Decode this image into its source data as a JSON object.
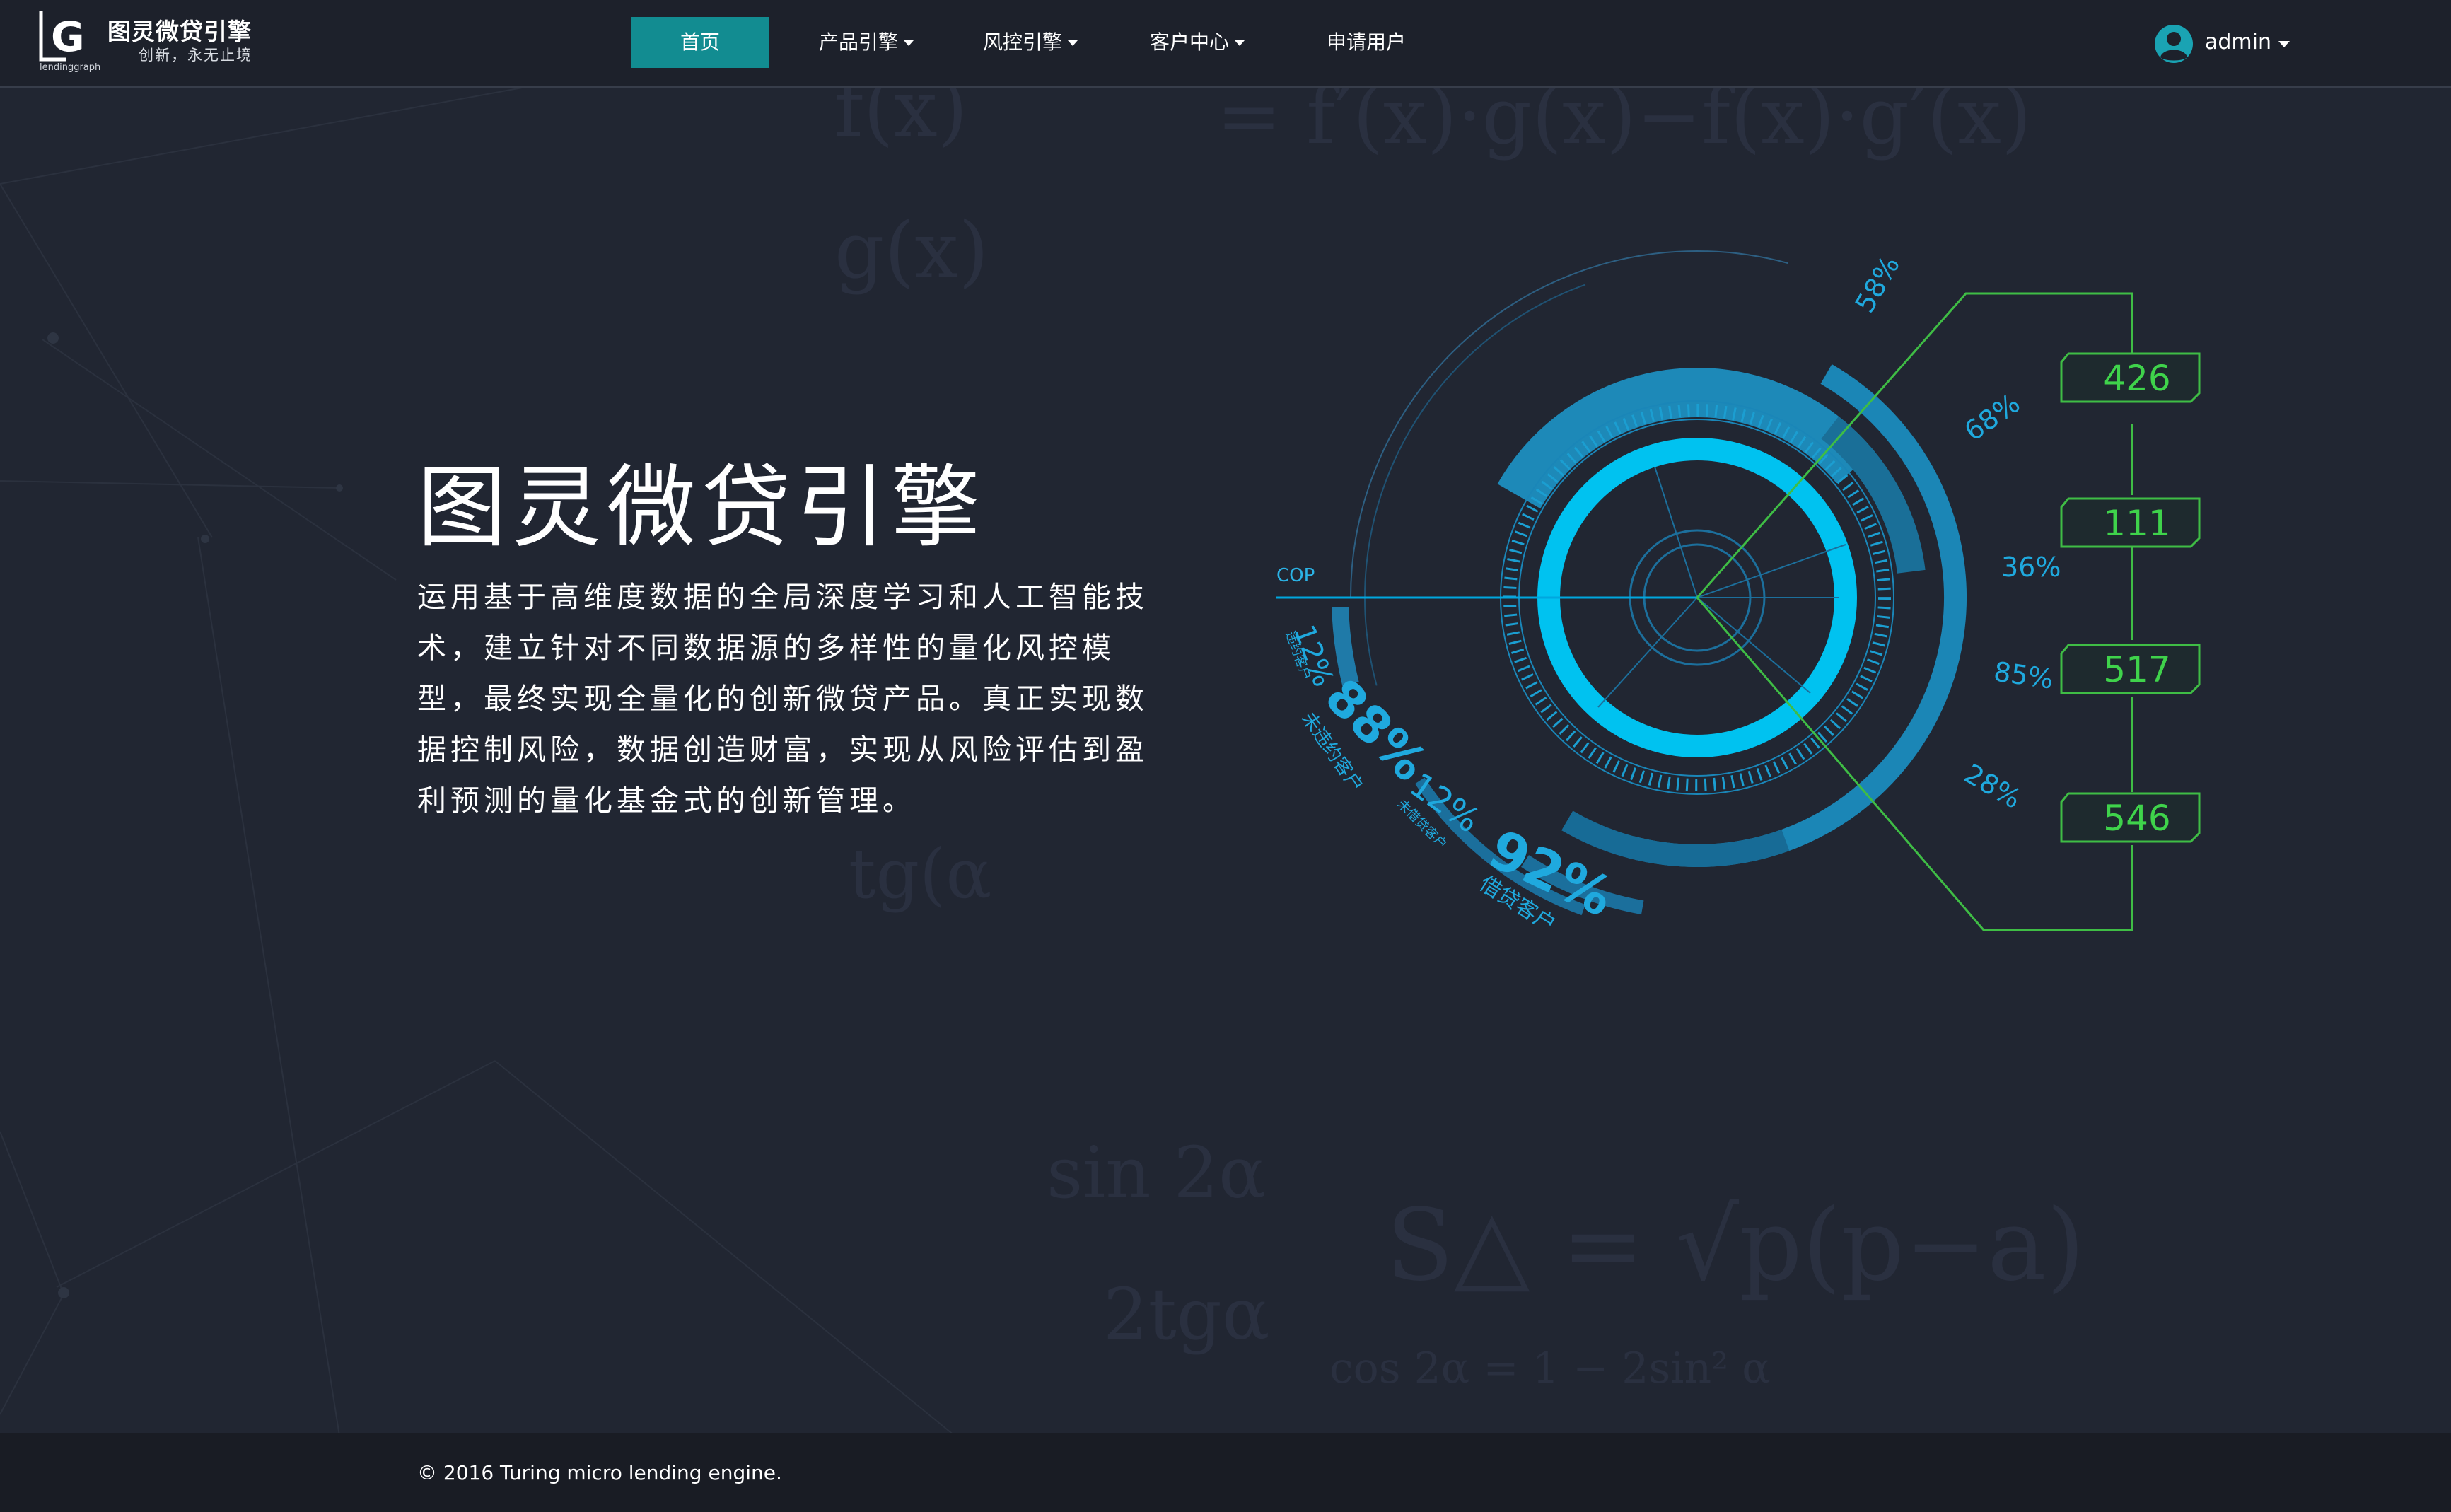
{
  "brand": {
    "logo_letters": "LG",
    "logo_caption": "lendinggraph",
    "title": "图灵微贷引擎",
    "slogan": "创新，永无止境"
  },
  "nav": {
    "items": [
      {
        "label": "首页",
        "active": true,
        "dropdown": false
      },
      {
        "label": "产品引擎",
        "active": false,
        "dropdown": true
      },
      {
        "label": "风控引擎",
        "active": false,
        "dropdown": true
      },
      {
        "label": "客户中心",
        "active": false,
        "dropdown": true
      },
      {
        "label": "申请用户",
        "active": false,
        "dropdown": false
      }
    ]
  },
  "user": {
    "name": "admin",
    "avatar_icon": "user-avatar-icon"
  },
  "hero": {
    "title": "图灵微贷引擎",
    "description": "运用基于高维度数据的全局深度学习和人工智能技术，建立针对不同数据源的多样性的量化风控模型，最终实现全量化的创新微贷产品。真正实现数据控制风险，数据创造财富，实现从风险评估到盈利预测的量化基金式的创新管理。"
  },
  "dashboard_graphic": {
    "cop_label": "COP",
    "ray_percents": [
      "58%",
      "68%",
      "36%",
      "85%",
      "28%"
    ],
    "counters": [
      "426",
      "111",
      "517",
      "546"
    ],
    "arc_stats": [
      {
        "value": "12%",
        "label": "违约客户"
      },
      {
        "value": "88%",
        "label": "未违约客户"
      },
      {
        "value": "12%",
        "label": "未借贷客户"
      },
      {
        "value": "92%",
        "label": "借贷客户"
      }
    ],
    "colors": {
      "primary": "#00c2f0",
      "secondary": "#1a7faa",
      "green": "#3fbd45",
      "nav_active": "#128c91"
    }
  },
  "footer": {
    "copyright": "© 2016 Turing micro lending engine."
  }
}
